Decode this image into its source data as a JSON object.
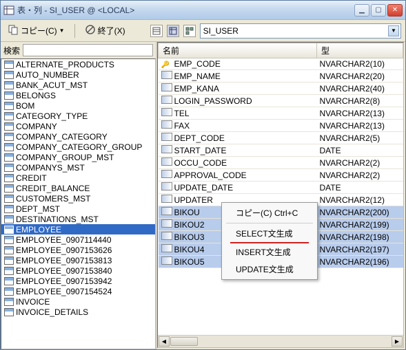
{
  "window": {
    "title": "表・列 - SI_USER @ <LOCAL>"
  },
  "toolbar": {
    "copy_label": "コピー(C)",
    "end_label": "終了(X)",
    "combo_value": "SI_USER"
  },
  "search": {
    "label": "検索",
    "value": ""
  },
  "tree": {
    "items": [
      "ALTERNATE_PRODUCTS",
      "AUTO_NUMBER",
      "BANK_ACUT_MST",
      "BELONGS",
      "BOM",
      "CATEGORY_TYPE",
      "COMPANY",
      "COMPANY_CATEGORY",
      "COMPANY_CATEGORY_GROUP",
      "COMPANY_GROUP_MST",
      "COMPANYS_MST",
      "CREDIT",
      "CREDIT_BALANCE",
      "CUSTOMERS_MST",
      "DEPT_MST",
      "DESTINATIONS_MST",
      "EMPLOYEE",
      "EMPLOYEE_0907114440",
      "EMPLOYEE_0907153626",
      "EMPLOYEE_0907153813",
      "EMPLOYEE_0907153840",
      "EMPLOYEE_0907153942",
      "EMPLOYEE_0907154524",
      "INVOICE",
      "INVOICE_DETAILS"
    ],
    "selected_index": 16
  },
  "grid": {
    "headers": {
      "name": "名前",
      "type": "型"
    },
    "rows": [
      {
        "name": "EMP_CODE",
        "type": "NVARCHAR2(10)",
        "key": true
      },
      {
        "name": "EMP_NAME",
        "type": "NVARCHAR2(20)",
        "key": false
      },
      {
        "name": "EMP_KANA",
        "type": "NVARCHAR2(40)",
        "key": false
      },
      {
        "name": "LOGIN_PASSWORD",
        "type": "NVARCHAR2(8)",
        "key": false
      },
      {
        "name": "TEL",
        "type": "NVARCHAR2(13)",
        "key": false
      },
      {
        "name": "FAX",
        "type": "NVARCHAR2(13)",
        "key": false
      },
      {
        "name": "DEPT_CODE",
        "type": "NVARCHAR2(5)",
        "key": false
      },
      {
        "name": "START_DATE",
        "type": "DATE",
        "key": false
      },
      {
        "name": "OCCU_CODE",
        "type": "NVARCHAR2(2)",
        "key": false
      },
      {
        "name": "APPROVAL_CODE",
        "type": "NVARCHAR2(2)",
        "key": false
      },
      {
        "name": "UPDATE_DATE",
        "type": "DATE",
        "key": false
      },
      {
        "name": "UPDATER",
        "type": "NVARCHAR2(12)",
        "key": false
      },
      {
        "name": "BIKOU",
        "type": "NVARCHAR2(200)",
        "key": false
      },
      {
        "name": "BIKOU2",
        "type": "NVARCHAR2(199)",
        "key": false
      },
      {
        "name": "BIKOU3",
        "type": "NVARCHAR2(198)",
        "key": false
      },
      {
        "name": "BIKOU4",
        "type": "NVARCHAR2(197)",
        "key": false
      },
      {
        "name": "BIKOU5",
        "type": "NVARCHAR2(196)",
        "key": false
      }
    ],
    "selection_start": 12,
    "selection_end": 16
  },
  "context_menu": {
    "copy": "コピー(C) Ctrl+C",
    "select_gen": "SELECT文生成",
    "insert_gen": "INSERT文生成",
    "update_gen": "UPDATE文生成"
  }
}
